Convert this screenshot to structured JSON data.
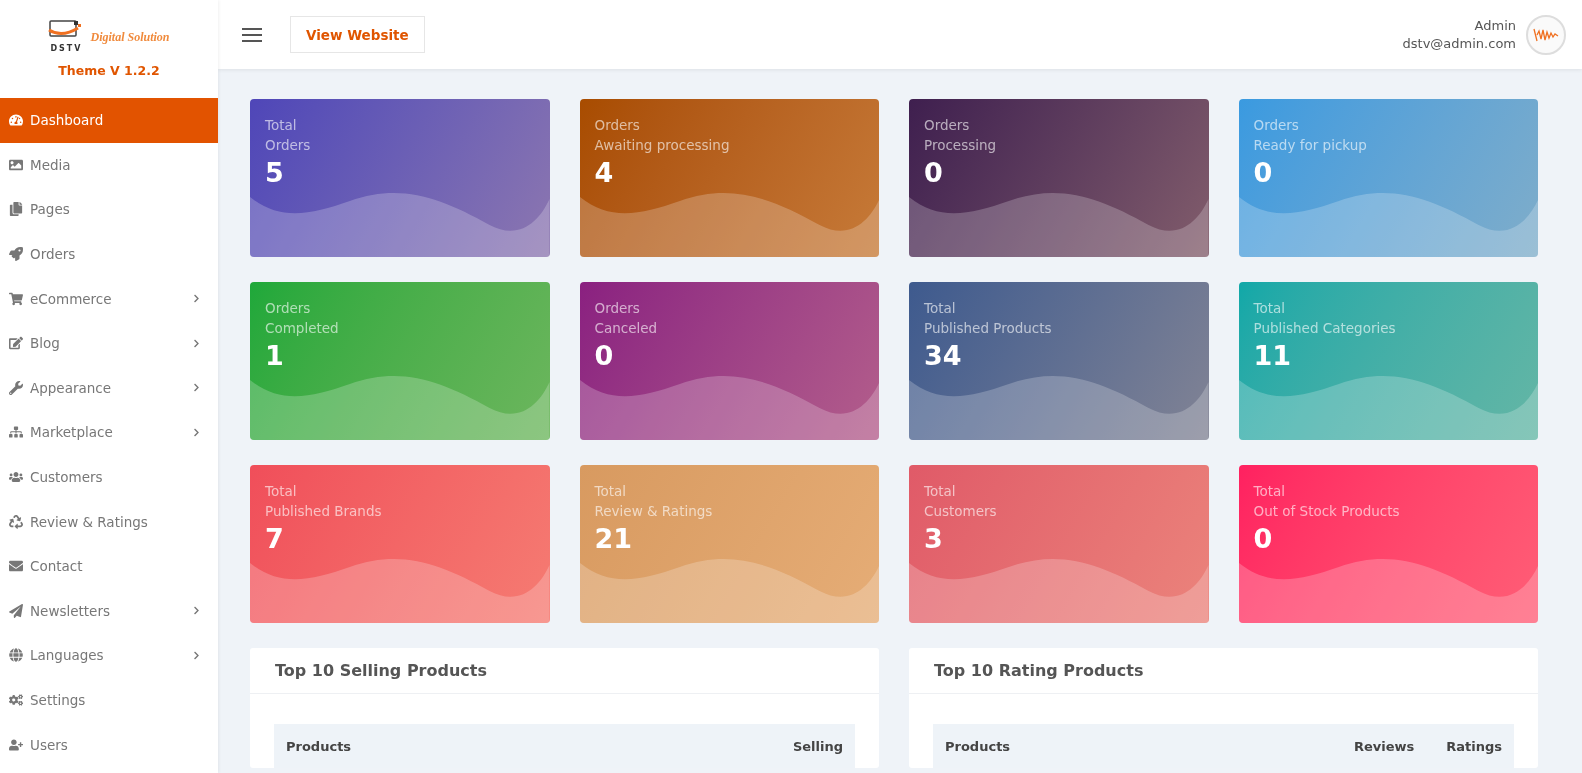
{
  "logo": {
    "mark": "DSTV",
    "tagline": "Digital Solution",
    "version": "Theme V 1.2.2"
  },
  "sidebar": {
    "items": [
      {
        "label": "Dashboard",
        "selected": true,
        "has_submenu": false
      },
      {
        "label": "Media",
        "selected": false,
        "has_submenu": false
      },
      {
        "label": "Pages",
        "selected": false,
        "has_submenu": false
      },
      {
        "label": "Orders",
        "selected": false,
        "has_submenu": false
      },
      {
        "label": "eCommerce",
        "selected": false,
        "has_submenu": true
      },
      {
        "label": "Blog",
        "selected": false,
        "has_submenu": true
      },
      {
        "label": "Appearance",
        "selected": false,
        "has_submenu": true
      },
      {
        "label": "Marketplace",
        "selected": false,
        "has_submenu": true
      },
      {
        "label": "Customers",
        "selected": false,
        "has_submenu": false
      },
      {
        "label": "Review & Ratings",
        "selected": false,
        "has_submenu": false
      },
      {
        "label": "Contact",
        "selected": false,
        "has_submenu": false
      },
      {
        "label": "Newsletters",
        "selected": false,
        "has_submenu": true
      },
      {
        "label": "Languages",
        "selected": false,
        "has_submenu": true
      },
      {
        "label": "Settings",
        "selected": false,
        "has_submenu": false
      },
      {
        "label": "Users",
        "selected": false,
        "has_submenu": false
      }
    ]
  },
  "header": {
    "button": "View Website",
    "user_name": "Admin",
    "user_email": "dstv@admin.com"
  },
  "stats": [
    {
      "line1": "Total",
      "line2": "Orders",
      "value": "5",
      "color": "#4f46b8"
    },
    {
      "line1": "Orders",
      "line2": "Awaiting processing",
      "value": "4",
      "color": "#a84c00"
    },
    {
      "line1": "Orders",
      "line2": "Processing",
      "value": "0",
      "color": "#3f1f4f"
    },
    {
      "line1": "Orders",
      "line2": "Ready for pickup",
      "value": "0",
      "color": "#3a9ae0"
    },
    {
      "line1": "Orders",
      "line2": "Completed",
      "value": "1",
      "color": "#1ea83a"
    },
    {
      "line1": "Orders",
      "line2": "Canceled",
      "value": "0",
      "color": "#8a2080"
    },
    {
      "line1": "Total",
      "line2": "Published Products",
      "value": "34",
      "color": "#3e5a8e"
    },
    {
      "line1": "Total",
      "line2": "Published Categories",
      "value": "11",
      "color": "#10a8a8"
    },
    {
      "line1": "Total",
      "line2": "Published Brands",
      "value": "7",
      "color": "#f04e5a"
    },
    {
      "line1": "Total",
      "line2": "Review & Ratings",
      "value": "21",
      "color": "#d89a60"
    },
    {
      "line1": "Total",
      "line2": "Customers",
      "value": "3",
      "color": "#e05a68"
    },
    {
      "line1": "Total",
      "line2": "Out of Stock Products",
      "value": "0",
      "color": "#ff2060"
    }
  ],
  "panels": [
    {
      "title": "Top 10 Selling Products",
      "columns": [
        "Products",
        "Selling"
      ]
    },
    {
      "title": "Top 10 Rating Products",
      "columns": [
        "Products",
        "Reviews",
        "Ratings"
      ]
    }
  ]
}
